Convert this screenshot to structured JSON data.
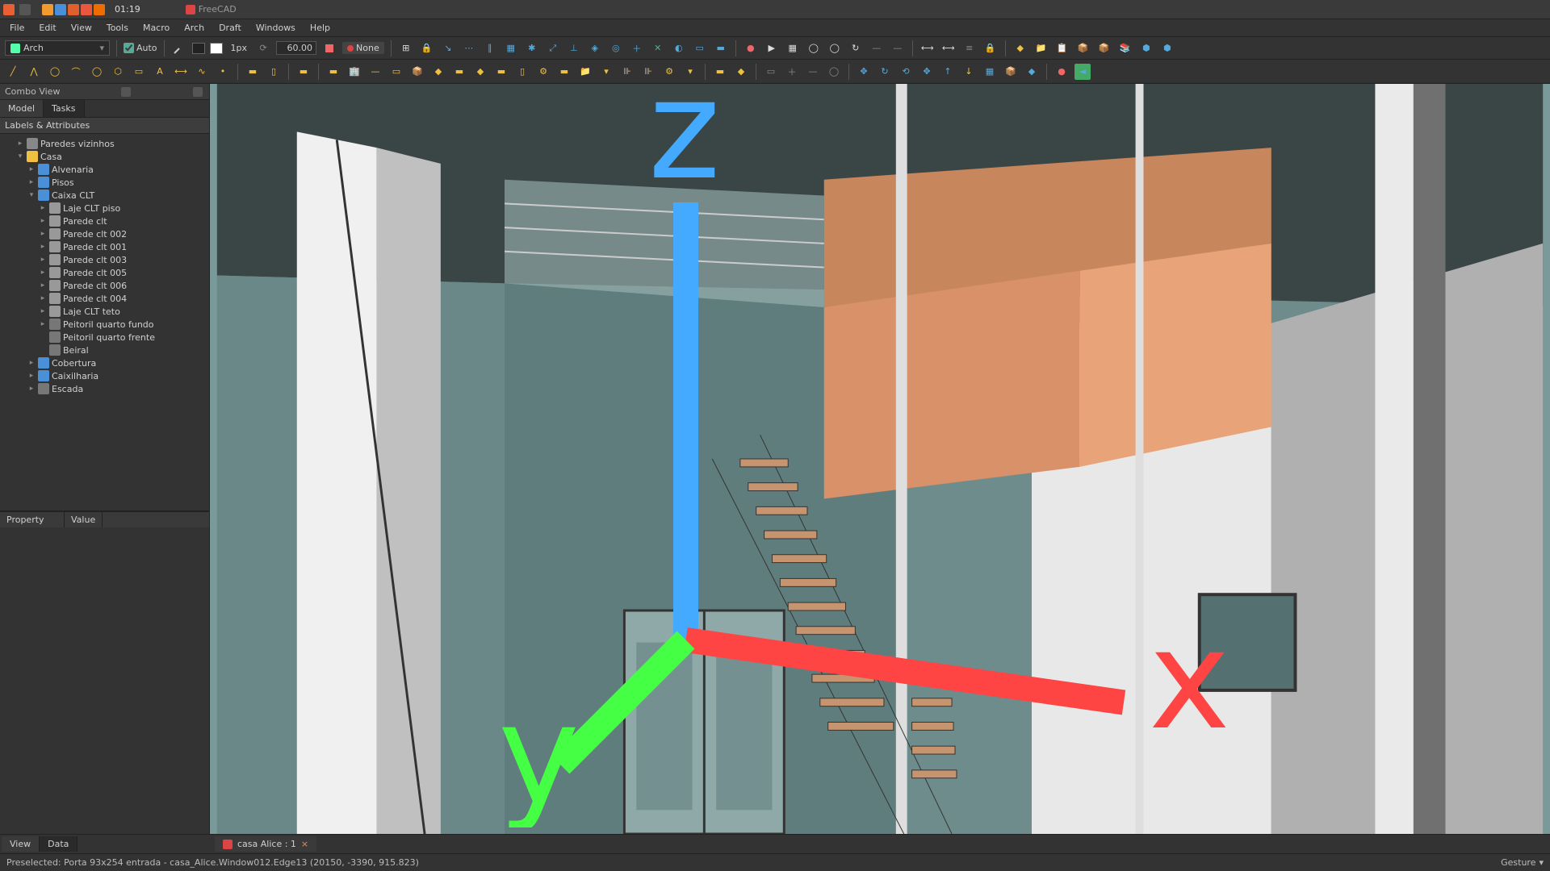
{
  "os": {
    "time": "01:19",
    "app_name": "FreeCAD"
  },
  "menubar": [
    "File",
    "Edit",
    "View",
    "Tools",
    "Macro",
    "Arch",
    "Draft",
    "Windows",
    "Help"
  ],
  "workbench": "Arch",
  "tb1": {
    "auto": "Auto",
    "px": "1px",
    "angle": "60.00",
    "none": "None"
  },
  "combo": {
    "title": "Combo View",
    "tab_model": "Model",
    "tab_tasks": "Tasks",
    "labels": "Labels & Attributes",
    "tree": [
      {
        "d": 0,
        "exp": "▸",
        "ic": "group",
        "t": "Paredes vizinhos"
      },
      {
        "d": 0,
        "exp": "▾",
        "ic": "yellow",
        "t": "Casa"
      },
      {
        "d": 1,
        "exp": "▸",
        "ic": "folder",
        "t": "Alvenaria"
      },
      {
        "d": 1,
        "exp": "▸",
        "ic": "folder",
        "t": "Pisos"
      },
      {
        "d": 1,
        "exp": "▾",
        "ic": "folder",
        "t": "Caixa CLT"
      },
      {
        "d": 2,
        "exp": "▸",
        "ic": "obj",
        "t": "Laje CLT piso"
      },
      {
        "d": 2,
        "exp": "▸",
        "ic": "obj",
        "t": "Parede clt"
      },
      {
        "d": 2,
        "exp": "▸",
        "ic": "obj",
        "t": "Parede clt 002"
      },
      {
        "d": 2,
        "exp": "▸",
        "ic": "obj",
        "t": "Parede clt 001"
      },
      {
        "d": 2,
        "exp": "▸",
        "ic": "obj",
        "t": "Parede clt 003"
      },
      {
        "d": 2,
        "exp": "▸",
        "ic": "obj",
        "t": "Parede clt 005"
      },
      {
        "d": 2,
        "exp": "▸",
        "ic": "obj",
        "t": "Parede clt 006"
      },
      {
        "d": 2,
        "exp": "▸",
        "ic": "obj",
        "t": "Parede clt 004"
      },
      {
        "d": 2,
        "exp": "▸",
        "ic": "obj",
        "t": "Laje CLT teto"
      },
      {
        "d": 2,
        "exp": "▸",
        "ic": "gray",
        "t": "Peitoril quarto fundo"
      },
      {
        "d": 2,
        "exp": "",
        "ic": "gray",
        "t": "Peitoril quarto frente"
      },
      {
        "d": 2,
        "exp": "",
        "ic": "gray",
        "t": "Beiral"
      },
      {
        "d": 1,
        "exp": "▸",
        "ic": "folder",
        "t": "Cobertura"
      },
      {
        "d": 1,
        "exp": "▸",
        "ic": "folder",
        "t": "Caixilharia"
      },
      {
        "d": 1,
        "exp": "▸",
        "ic": "gray",
        "t": "Escada"
      }
    ],
    "prop": "Property",
    "val": "Value"
  },
  "bottom_tabs": {
    "view": "View",
    "data": "Data"
  },
  "doc_tab": "casa Alice : 1",
  "status": {
    "msg": "Preselected: Porta 93x254 entrada - casa_Alice.Window012.Edge13 (20150, -3390, 915.823)",
    "nav": "Gesture"
  }
}
